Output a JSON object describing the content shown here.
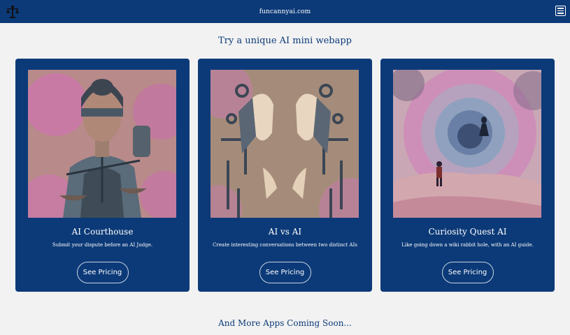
{
  "header": {
    "site_name": "funcannyai.com",
    "logo_icon": "scales-icon",
    "menu_icon": "hamburger-menu-icon"
  },
  "main": {
    "heading": "Try a unique AI mini webapp",
    "cards": [
      {
        "title": "AI Courthouse",
        "description": "Submit your dispute before an AI Judge.",
        "button_label": "See Pricing",
        "image": "blindfolded-justice-robot-with-scales"
      },
      {
        "title": "AI vs AI",
        "description": "Create interesting conversations between two distinct AIs",
        "button_label": "See Pricing",
        "image": "two-robot-faces-facing-each-other"
      },
      {
        "title": "Curiosity Quest AI",
        "description": "Like going down a wiki rabbit hole, with an AI guide.",
        "button_label": "See Pricing",
        "image": "figure-before-swirling-portal"
      }
    ],
    "footer_text": "And More Apps Coming Soon..."
  },
  "colors": {
    "brand": "#0c3a78",
    "background": "#f2f2f2",
    "card_text": "#ffffff"
  }
}
